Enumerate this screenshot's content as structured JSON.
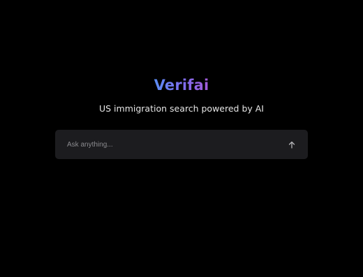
{
  "brand": {
    "name": "Verifai"
  },
  "hero": {
    "tagline": "US immigration search powered by AI"
  },
  "search": {
    "placeholder": "Ask anything...",
    "value": "",
    "submit_icon": "arrow-up-icon"
  },
  "colors": {
    "background": "#000000",
    "logo_gradient_start": "#5b8cf2",
    "logo_gradient_end": "#a35bd8",
    "search_box": "#1c1c1f",
    "tagline_text": "#e6e6e6"
  }
}
